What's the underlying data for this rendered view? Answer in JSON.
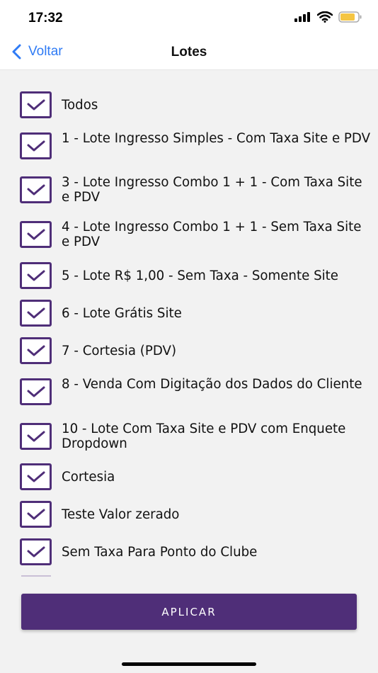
{
  "status": {
    "time": "17:32"
  },
  "nav": {
    "back_label": "Voltar",
    "title": "Lotes"
  },
  "items": [
    {
      "label": "Todos",
      "checked": true
    },
    {
      "label": "1 - Lote Ingresso Simples - Com Taxa Site e PDV",
      "checked": true
    },
    {
      "label": "3 - Lote Ingresso Combo 1 + 1 - Com Taxa Site e PDV",
      "checked": true
    },
    {
      "label": "4 - Lote Ingresso Combo 1 + 1 - Sem Taxa Site e PDV",
      "checked": true
    },
    {
      "label": "5 - Lote R$ 1,00 - Sem Taxa - Somente Site",
      "checked": true
    },
    {
      "label": "6 - Lote Grátis Site",
      "checked": true
    },
    {
      "label": "7 - Cortesia (PDV)",
      "checked": true
    },
    {
      "label": "8 - Venda Com Digitação dos Dados do Cliente",
      "checked": true
    },
    {
      "label": "10 - Lote Com Taxa Site e PDV com Enquete Dropdown",
      "checked": true
    },
    {
      "label": "Cortesia",
      "checked": true
    },
    {
      "label": "Teste Valor zerado",
      "checked": true
    },
    {
      "label": "Sem Taxa Para Ponto do Clube",
      "checked": true
    }
  ],
  "apply_label": "APLICAR",
  "colors": {
    "accent": "#4f2e78",
    "link": "#2f7bf5",
    "background": "#f2f2f2",
    "battery": "#f5c542"
  }
}
